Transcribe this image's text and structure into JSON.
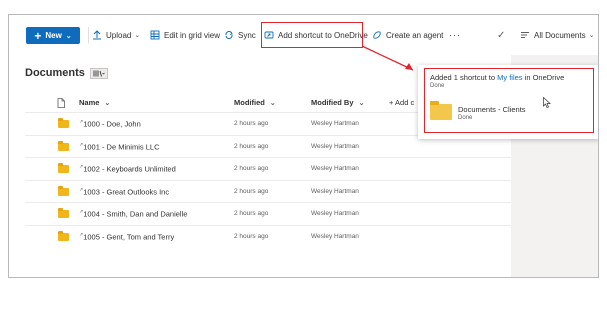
{
  "toolbar": {
    "new_label": "New",
    "upload_label": "Upload",
    "edit_grid_label": "Edit in grid view",
    "sync_label": "Sync",
    "add_shortcut_label": "Add shortcut to OneDrive",
    "create_agent_label": "Create an agent",
    "more_label": "···",
    "all_documents_label": "All Documents"
  },
  "page": {
    "title": "Documents"
  },
  "list": {
    "columns": {
      "name": "Name",
      "modified": "Modified",
      "modified_by": "Modified By",
      "add_column": "+ Add c"
    },
    "rows": [
      {
        "name": "1000 - Doe, John",
        "modified": "2 hours ago",
        "modified_by": "Wesley Hartman"
      },
      {
        "name": "1001 - De Minimis LLC",
        "modified": "2 hours ago",
        "modified_by": "Wesley Hartman"
      },
      {
        "name": "1002 - Keyboards Unlimited",
        "modified": "2 hours ago",
        "modified_by": "Wesley Hartman"
      },
      {
        "name": "1003 - Great Outlooks Inc",
        "modified": "2 hours ago",
        "modified_by": "Wesley Hartman"
      },
      {
        "name": "1004 - Smith, Dan and Danielle",
        "modified": "2 hours ago",
        "modified_by": "Wesley Hartman"
      },
      {
        "name": "1005 - Gent, Tom and Terry",
        "modified": "2 hours ago",
        "modified_by": "Wesley Hartman"
      }
    ]
  },
  "popup": {
    "msg_prefix": "Added 1 shortcut to ",
    "msg_link": "My files",
    "msg_suffix": " in OneDrive",
    "status": "Done",
    "item_name": "Documents - Clients",
    "item_status": "Done"
  },
  "colors": {
    "accent": "#0f6cbd",
    "highlight": "#e0262c",
    "folder": "#f2b61d"
  },
  "icons": [
    "plus-icon",
    "upload-icon",
    "grid-icon",
    "sync-icon",
    "shortcut-icon",
    "agent-icon",
    "more-icon",
    "check-icon",
    "view-list-icon",
    "file-icon",
    "folder-icon",
    "cursor-icon"
  ]
}
